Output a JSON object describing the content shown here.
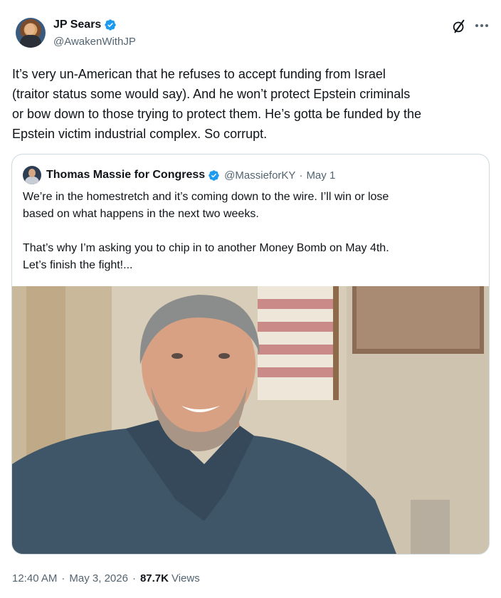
{
  "author": {
    "display_name": "JP Sears",
    "handle": "@AwakenWithJP",
    "verified": true
  },
  "tweet": {
    "text": "It’s very un-American that he refuses to accept funding from Israel\n(traitor status some would say). And he won’t protect Epstein criminals\nor bow down to those trying to protect them. He’s gotta be funded by the\nEpstein victim industrial complex. So corrupt."
  },
  "quoted_tweet": {
    "display_name": "Thomas Massie for Congress",
    "handle": "@MassieforKY",
    "separator": "·",
    "date": "May 1",
    "verified": true,
    "text": "We’re in the homestretch and it’s coming down to the wire. I’ll win or lose\nbased on what happens in the next two weeks.\n\nThat’s why I’m asking you to chip in to another Money Bomb on May 4th.\nLet’s finish the fight!..."
  },
  "meta": {
    "time": "12:40 AM",
    "dot1": "·",
    "date": "May 3, 2026",
    "dot2": "·",
    "views_count": "87.7K",
    "views_label": "Views"
  },
  "icons": {
    "verified": "verified-badge-icon",
    "grok": "grok-icon",
    "more": "more-options-icon"
  },
  "colors": {
    "verified_blue": "#1d9bf0",
    "secondary_text": "#536471",
    "primary_text": "#0f1419",
    "border": "#cfd9de"
  }
}
